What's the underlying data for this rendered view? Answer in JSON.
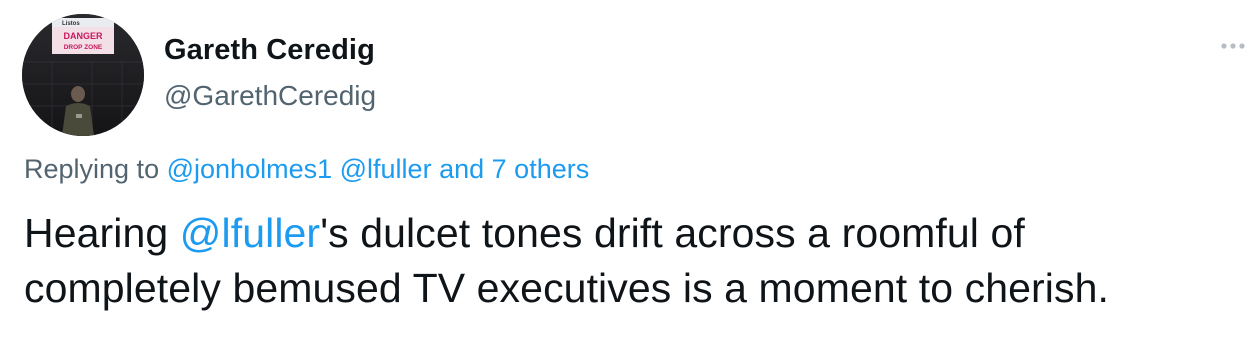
{
  "author": {
    "display_name": "Gareth Ceredig",
    "handle": "@GarethCeredig"
  },
  "avatar_sign": {
    "top_line": "Listos",
    "line1": "DANGER",
    "line2": "DROP ZONE"
  },
  "menu": {
    "icon": "more-horizontal-icon"
  },
  "reply_context": {
    "prefix": "Replying to",
    "mention1": "@jonholmes1",
    "mention2": "@lfuller",
    "connector": "and",
    "others": "7 others"
  },
  "tweet": {
    "text_before": "Hearing ",
    "mention": "@lfuller",
    "line1_after": "'s dulcet tones drift across a roomful of",
    "line2": "completely bemused TV executives is a moment to cherish."
  },
  "colors": {
    "link": "#1d9bf0",
    "secondary": "#536471",
    "primary_text": "#0f1419"
  }
}
